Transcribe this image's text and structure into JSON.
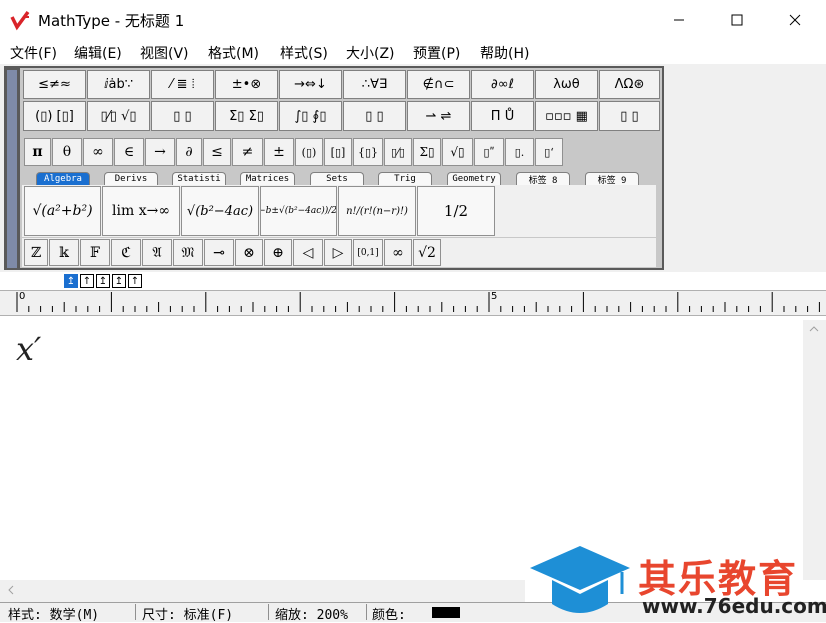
{
  "window": {
    "title": "MathType - 无标题 1"
  },
  "menu": [
    "文件(F)",
    "编辑(E)",
    "视图(V)",
    "格式(M)",
    "样式(S)",
    "大小(Z)",
    "预置(P)",
    "帮助(H)"
  ],
  "palette": {
    "row1": [
      "≤≠≈",
      "ⅈȧb∵",
      "⁄ ≣ ⦙",
      "±•⊗",
      "→⇔↓",
      "∴∀∃",
      "∉∩⊂",
      "∂∞ℓ",
      "λωθ",
      "ΛΩ⊛"
    ],
    "row2": [
      "(▯) [▯]",
      "▯⁄▯ √▯",
      "▯ ▯",
      "Σ▯ Σ▯",
      "∫▯ ∮▯",
      "▯ ▯",
      "⇀ ⇌",
      "Π̄ Ů",
      "▫▫▫ ▦",
      "▯ ▯"
    ],
    "row3": [
      "π",
      "θ",
      "∞",
      "∈",
      "→",
      "∂",
      "≤",
      "≠",
      "±",
      "(▯)",
      "[▯]",
      "{▯}",
      "▯⁄▯",
      "Σ▯",
      "√▯",
      "▯ʺ",
      "▯.",
      "▯ʻ"
    ],
    "tabs": [
      "Algebra",
      "Derivs",
      "Statisti",
      "Matrices",
      "Sets",
      "Trig",
      "Geometry",
      "标签 8",
      "标签 9"
    ],
    "templates": [
      "√(a²+b²)",
      "lim x→∞",
      "√(b²−4ac)",
      "(−b±√(b²−4ac))/2a",
      "n!/(r!(n−r)!)",
      "1/2"
    ],
    "row5": [
      "ℤ",
      "𝕜",
      "𝔽",
      "ℭ",
      "𝔄",
      "𝔐",
      "⊸",
      "⊗",
      "⊕",
      "◁",
      "▷",
      "[0,1]",
      "∞",
      "√2"
    ]
  },
  "small_toolbar": [
    "↥",
    "↑",
    "↥",
    "↥",
    "↑"
  ],
  "ruler": {
    "marks": [
      "0",
      "5"
    ]
  },
  "document": {
    "formula": "x′"
  },
  "status": {
    "style": "样式: 数学(M)",
    "size": "尺寸: 标准(F)",
    "zoom": "缩放: 200%",
    "color_label": "颜色:",
    "color_value": "#000000"
  },
  "watermark": {
    "name": "其乐教育",
    "url": "www.76edu.com",
    "cap_color": "#1e8fd6"
  }
}
